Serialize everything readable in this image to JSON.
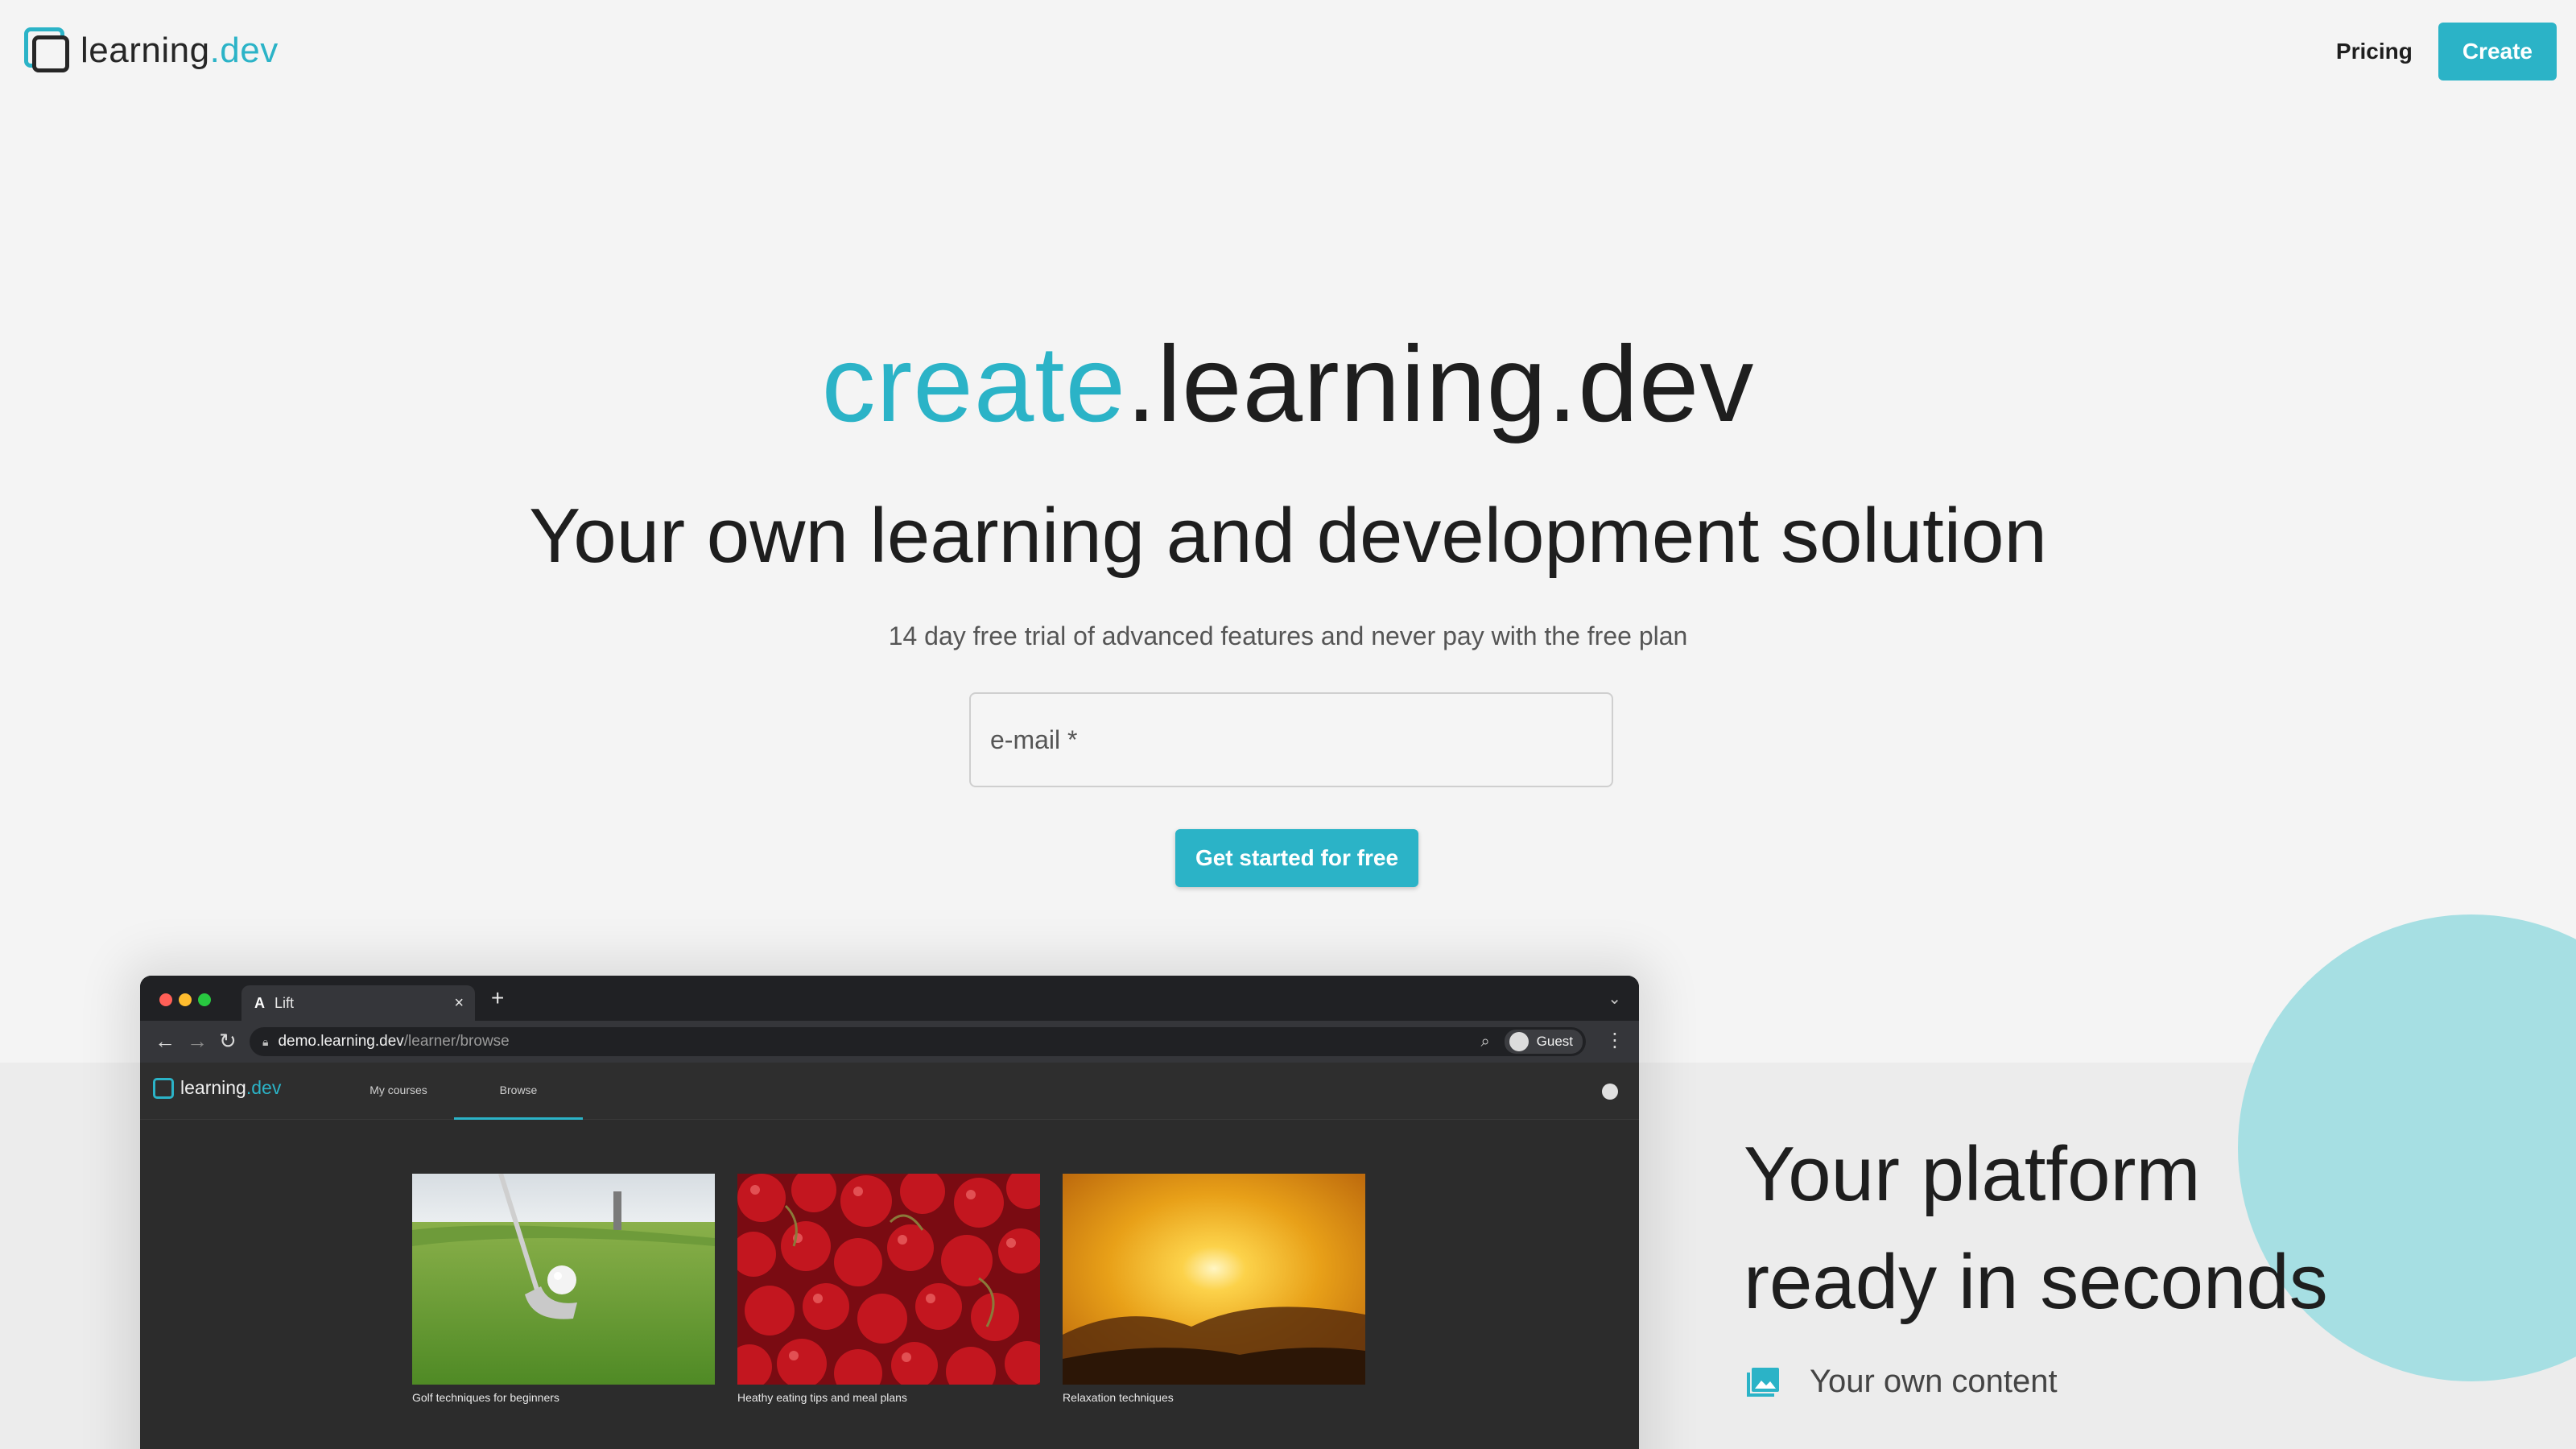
{
  "header": {
    "logo": {
      "text_main": "learning",
      "text_accent": ".dev",
      "icon": "logo-icon"
    },
    "nav": {
      "pricing_label": "Pricing",
      "create_label": "Create"
    }
  },
  "hero": {
    "title_accent": "create",
    "title_rest": ".learning.dev",
    "subtitle": "Your own learning and development solution",
    "note": "14 day free trial of advanced features and never pay with the free plan",
    "email_placeholder": "e-mail *",
    "cta_label": "Get started for free"
  },
  "browser_mockup": {
    "tab": {
      "favicon": "A",
      "title": "Lift",
      "close": "×"
    },
    "new_tab": "+",
    "url_host": "demo.learning.dev",
    "url_path": "/learner/browse",
    "profile_label": "Guest",
    "app": {
      "logo_main": "learning",
      "logo_accent": ".dev",
      "tabs": [
        {
          "label": "My courses",
          "active": false
        },
        {
          "label": "Browse",
          "active": true
        }
      ],
      "courses": [
        {
          "title": "Golf techniques for beginners",
          "image": "golf-ball-on-grass"
        },
        {
          "title": "Heathy eating tips and meal plans",
          "image": "cherries"
        },
        {
          "title": "Relaxation techniques",
          "image": "sunset-over-hills"
        }
      ]
    }
  },
  "platform": {
    "title_line1": "Your platform",
    "title_line2": "ready in seconds",
    "features": [
      {
        "icon": "image-icon",
        "label": "Your own content"
      }
    ]
  },
  "colors": {
    "accent": "#2bb3c7",
    "background": "#f4f4f4",
    "circle": "#a6dfe3",
    "browser_dark": "#2c2c2c"
  }
}
